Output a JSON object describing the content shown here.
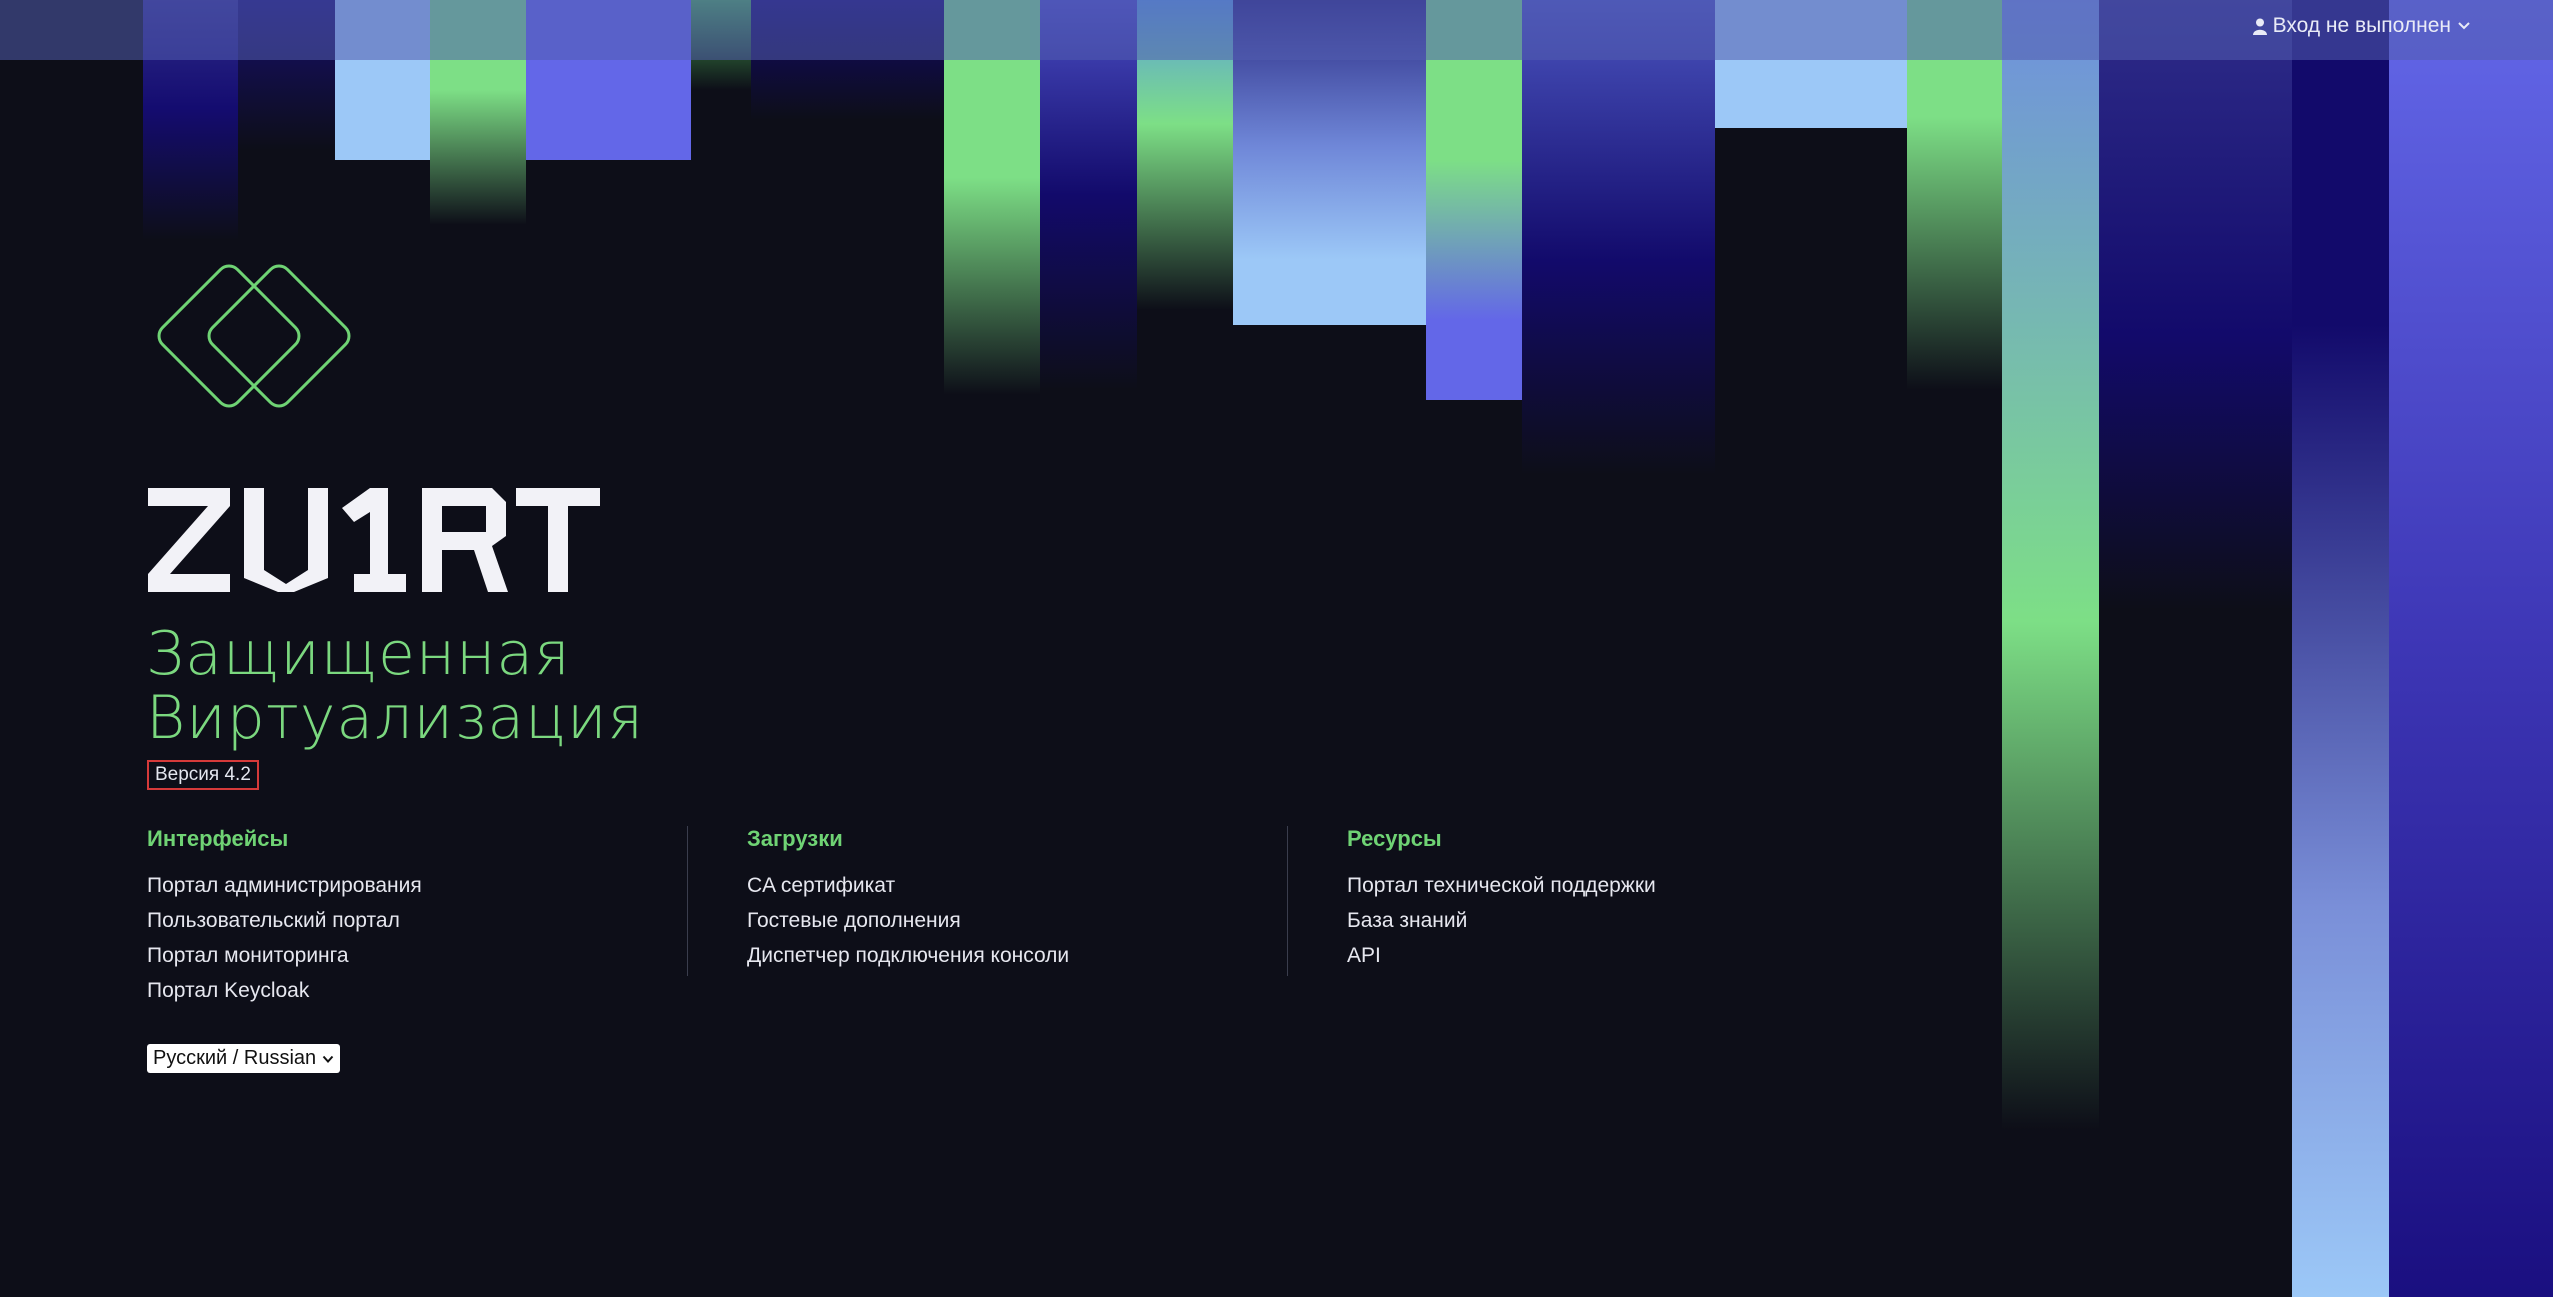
{
  "header": {
    "login_label": "Вход не выполнен",
    "user_icon": "user-icon",
    "chevron_icon": "chevron-down-icon"
  },
  "brand": {
    "logo_icon": "diamond-logo-icon",
    "wordmark": "ZVIRT",
    "subtitle_line1": "Защищенная",
    "subtitle_line2": "Виртуализация",
    "version": "Версия 4.2"
  },
  "sections": [
    {
      "title": "Интерфейсы",
      "items": [
        "Портал администрирования",
        "Пользовательский портал",
        "Портал мониторинга",
        "Портал Keycloak"
      ]
    },
    {
      "title": "Загрузки",
      "items": [
        "CA сертификат",
        "Гостевые дополнения",
        "Диспетчер подключения консоли"
      ]
    },
    {
      "title": "Ресурсы",
      "items": [
        "Портал технической поддержки",
        "База знаний",
        "API"
      ]
    }
  ],
  "language": {
    "selected": "Русский / Russian"
  },
  "colors": {
    "background": "#0d0e18",
    "accent_green": "#6fd374",
    "accent_blue": "#6367e8",
    "light_blue": "#9cc8f7",
    "deep_indigo": "#120a6b",
    "version_border": "#d63a3a"
  }
}
